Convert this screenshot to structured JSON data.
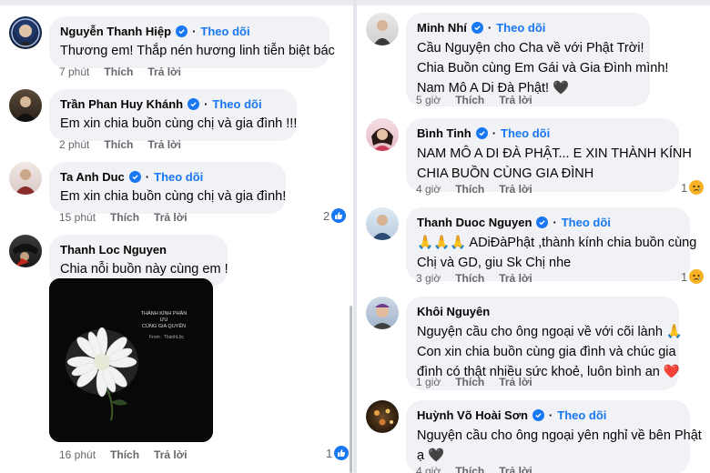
{
  "left_comments": [
    {
      "author": "Nguyễn Thanh Hiệp",
      "verified": true,
      "follow": "Theo dõi",
      "lines": [
        "Thương em! Thắp nén hương linh tiễn biệt bác"
      ],
      "time": "7 phút",
      "like": "Thích",
      "reply": "Trả lời"
    },
    {
      "author": "Trần Phan Huy Khánh",
      "verified": true,
      "follow": "Theo dõi",
      "lines": [
        "Em xin chia buồn cùng chị và gia đình !!!"
      ],
      "time": "2 phút",
      "like": "Thích",
      "reply": "Trả lời"
    },
    {
      "author": "Ta Anh Duc",
      "verified": true,
      "follow": "Theo dõi",
      "lines": [
        "Em xin chia buồn cùng chị và gia đình!"
      ],
      "time": "15 phút",
      "like": "Thích",
      "reply": "Trả lời",
      "reaction_count": "2",
      "reaction": "like"
    },
    {
      "author": "Thanh Loc Nguyen",
      "verified": false,
      "follow": "",
      "lines": [
        "Chia nỗi buồn này cùng em !"
      ],
      "time": "16 phút",
      "like": "Thích",
      "reply": "Trả lời",
      "reaction_count": "1",
      "reaction": "like",
      "image": {
        "caption_title": "THÀNH KÍNH PHÂN ƯU\nCÙNG GIA QUYẾN",
        "caption_from": "From : ThànhLộc"
      }
    }
  ],
  "right_comments": [
    {
      "author": "Minh Nhí",
      "verified": true,
      "follow": "Theo dõi",
      "lines": [
        "Cầu Nguyện cho Cha về với Phật Trời!",
        "Chia Buồn cùng Em Gái và Gia Đình mình!",
        "Nam Mô A Di Đà Phật! 🖤"
      ],
      "time": "5 giờ",
      "like": "Thích",
      "reply": "Trả lời"
    },
    {
      "author": "Bình Tinh",
      "verified": true,
      "follow": "Theo dõi",
      "lines": [
        "NAM MÔ A DI ĐÀ PHẬT... E XIN THÀNH KÍNH",
        "CHIA BUỒN CÙNG GIA ĐÌNH"
      ],
      "time": "4 giờ",
      "like": "Thích",
      "reply": "Trả lời",
      "reaction_count": "1",
      "reaction": "sad"
    },
    {
      "author": "Thanh Duoc Nguyen",
      "verified": true,
      "follow": "Theo dõi",
      "lines": [
        "🙏🙏🙏 ADiĐàPhật ,thành kính chia buồn cùng",
        "Chị và GD, giu Sk Chị nhe"
      ],
      "time": "3 giờ",
      "like": "Thích",
      "reply": "Trả lời",
      "reaction_count": "1",
      "reaction": "sad"
    },
    {
      "author": "Khôi Nguyên",
      "verified": false,
      "follow": "",
      "lines": [
        "Nguyện cầu cho ông ngoại về với cõi lành 🙏",
        "Con xin chia buồn cùng gia đình và chúc gia",
        "đình có thật nhiều sức khoẻ, luôn bình an ❤️"
      ],
      "time": "1 giờ",
      "like": "Thích",
      "reply": "Trả lời"
    },
    {
      "author": "Huỳnh Võ Hoài Sơn",
      "verified": true,
      "follow": "Theo dõi",
      "lines": [
        "Nguyện cầu cho ông ngoại yên nghỉ về bên Phật",
        "ạ 🖤"
      ],
      "time": "4 giờ",
      "like": "Thích",
      "reply": "Trả lời"
    }
  ]
}
